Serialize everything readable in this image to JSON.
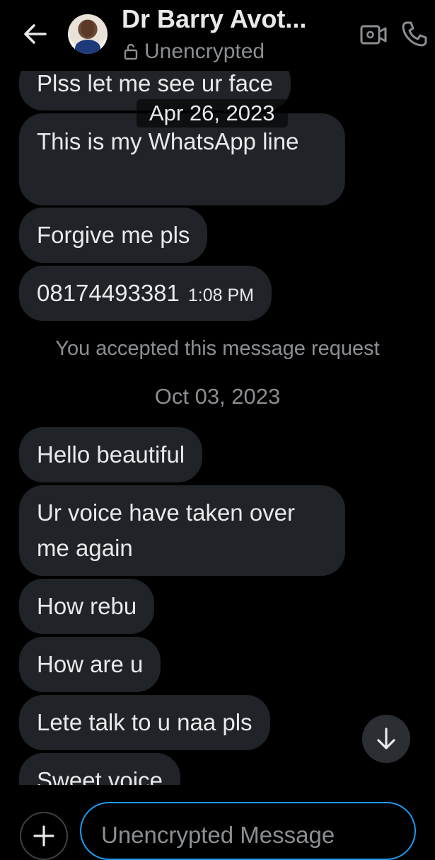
{
  "header": {
    "contact_name": "Dr Barry Avot...",
    "status": "Unencrypted",
    "icons": {
      "back": "arrow-left-icon",
      "lock": "lock-icon",
      "video": "video-camera-icon",
      "call": "phone-icon"
    }
  },
  "messages_early": [
    "Plss let me see ur face",
    "This is my WhatsApp line",
    "Forgive me pls"
  ],
  "phone_message": {
    "text": "08174493381",
    "time": "1:08 PM"
  },
  "date_overlay": "Apr 26, 2023",
  "system_notice": "You accepted this message request",
  "date_divider": "Oct 03, 2023",
  "messages_late": [
    "Hello beautiful",
    "Ur voice have taken over me again",
    "How rebu",
    "How are u",
    "Lete talk to u naa pls",
    "Sweet voice"
  ],
  "composer": {
    "placeholder": "Unencrypted Message",
    "icons": {
      "add": "plus-icon",
      "scroll": "arrow-down-icon"
    }
  },
  "colors": {
    "background": "#000000",
    "bubble": "#202327",
    "text": "#e7e9ea",
    "muted": "#8b8f93",
    "accent": "#1d9bf0"
  }
}
